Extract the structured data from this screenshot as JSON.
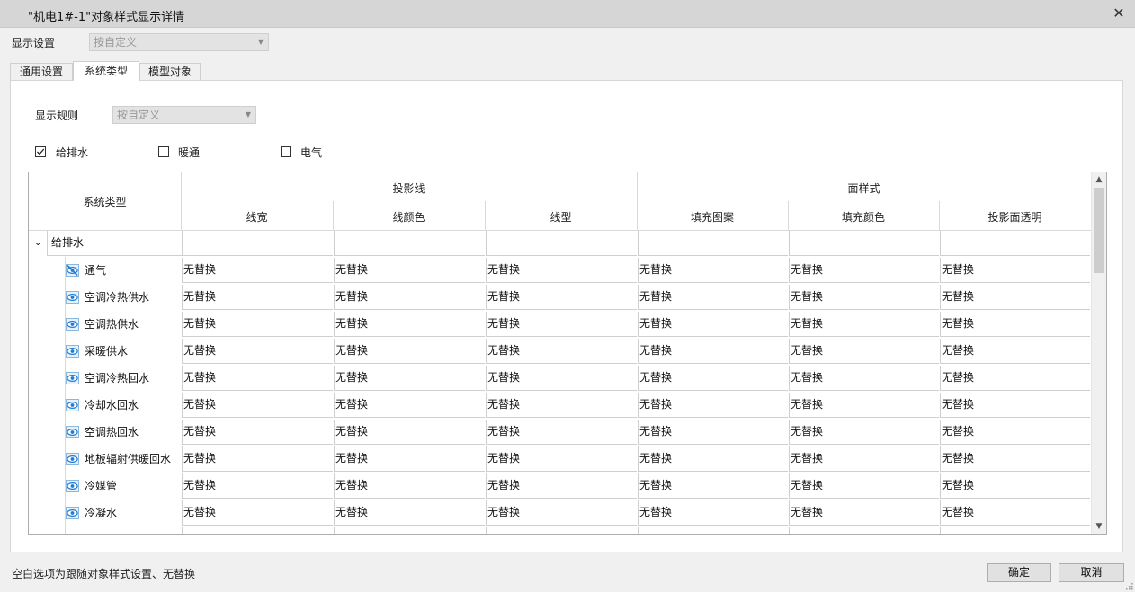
{
  "window": {
    "title": "\"机电1#-1\"对象样式显示详情"
  },
  "display_setting": {
    "label": "显示设置",
    "value": "按自定义"
  },
  "tabs": [
    {
      "label": "通用设置",
      "active": false
    },
    {
      "label": "系统类型",
      "active": true
    },
    {
      "label": "模型对象",
      "active": false
    }
  ],
  "display_rule": {
    "label": "显示规则",
    "value": "按自定义"
  },
  "checkboxes": [
    {
      "label": "给排水",
      "checked": true
    },
    {
      "label": "暖通",
      "checked": false
    },
    {
      "label": "电气",
      "checked": false
    }
  ],
  "table": {
    "col_system": "系统类型",
    "group_projection": "投影线",
    "group_surface": "面样式",
    "columns": [
      "线宽",
      "线颜色",
      "线型",
      "填充图案",
      "填充颜色",
      "投影面透明"
    ],
    "group_row": "给排水",
    "rows": [
      {
        "name": "通气",
        "icon": "hidden-eye-icon",
        "values": [
          "无替换",
          "无替换",
          "无替换",
          "无替换",
          "无替换",
          "无替换"
        ]
      },
      {
        "name": "空调冷热供水",
        "icon": "eye-icon",
        "values": [
          "无替换",
          "无替换",
          "无替换",
          "无替换",
          "无替换",
          "无替换"
        ]
      },
      {
        "name": "空调热供水",
        "icon": "eye-icon",
        "values": [
          "无替换",
          "无替换",
          "无替换",
          "无替换",
          "无替换",
          "无替换"
        ]
      },
      {
        "name": "采暖供水",
        "icon": "eye-icon",
        "values": [
          "无替换",
          "无替换",
          "无替换",
          "无替换",
          "无替换",
          "无替换"
        ]
      },
      {
        "name": "空调冷热回水",
        "icon": "eye-icon",
        "values": [
          "无替换",
          "无替换",
          "无替换",
          "无替换",
          "无替换",
          "无替换"
        ]
      },
      {
        "name": "冷却水回水",
        "icon": "eye-icon",
        "values": [
          "无替换",
          "无替换",
          "无替换",
          "无替换",
          "无替换",
          "无替换"
        ]
      },
      {
        "name": "空调热回水",
        "icon": "eye-icon",
        "values": [
          "无替换",
          "无替换",
          "无替换",
          "无替换",
          "无替换",
          "无替换"
        ]
      },
      {
        "name": "地板辐射供暖回水",
        "icon": "eye-icon",
        "values": [
          "无替换",
          "无替换",
          "无替换",
          "无替换",
          "无替换",
          "无替换"
        ]
      },
      {
        "name": "冷媒管",
        "icon": "eye-icon",
        "values": [
          "无替换",
          "无替换",
          "无替换",
          "无替换",
          "无替换",
          "无替换"
        ]
      },
      {
        "name": "冷凝水",
        "icon": "eye-icon",
        "values": [
          "无替换",
          "无替换",
          "无替换",
          "无替换",
          "无替换",
          "无替换"
        ]
      }
    ]
  },
  "footer": {
    "hint": "空白选项为跟随对象样式设置、无替换",
    "ok_label": "确定",
    "cancel_label": "取消"
  },
  "colors": {
    "accent": "#1c7cd6",
    "titlebar": "#d6d6d6",
    "dialog": "#f0f0f0"
  }
}
